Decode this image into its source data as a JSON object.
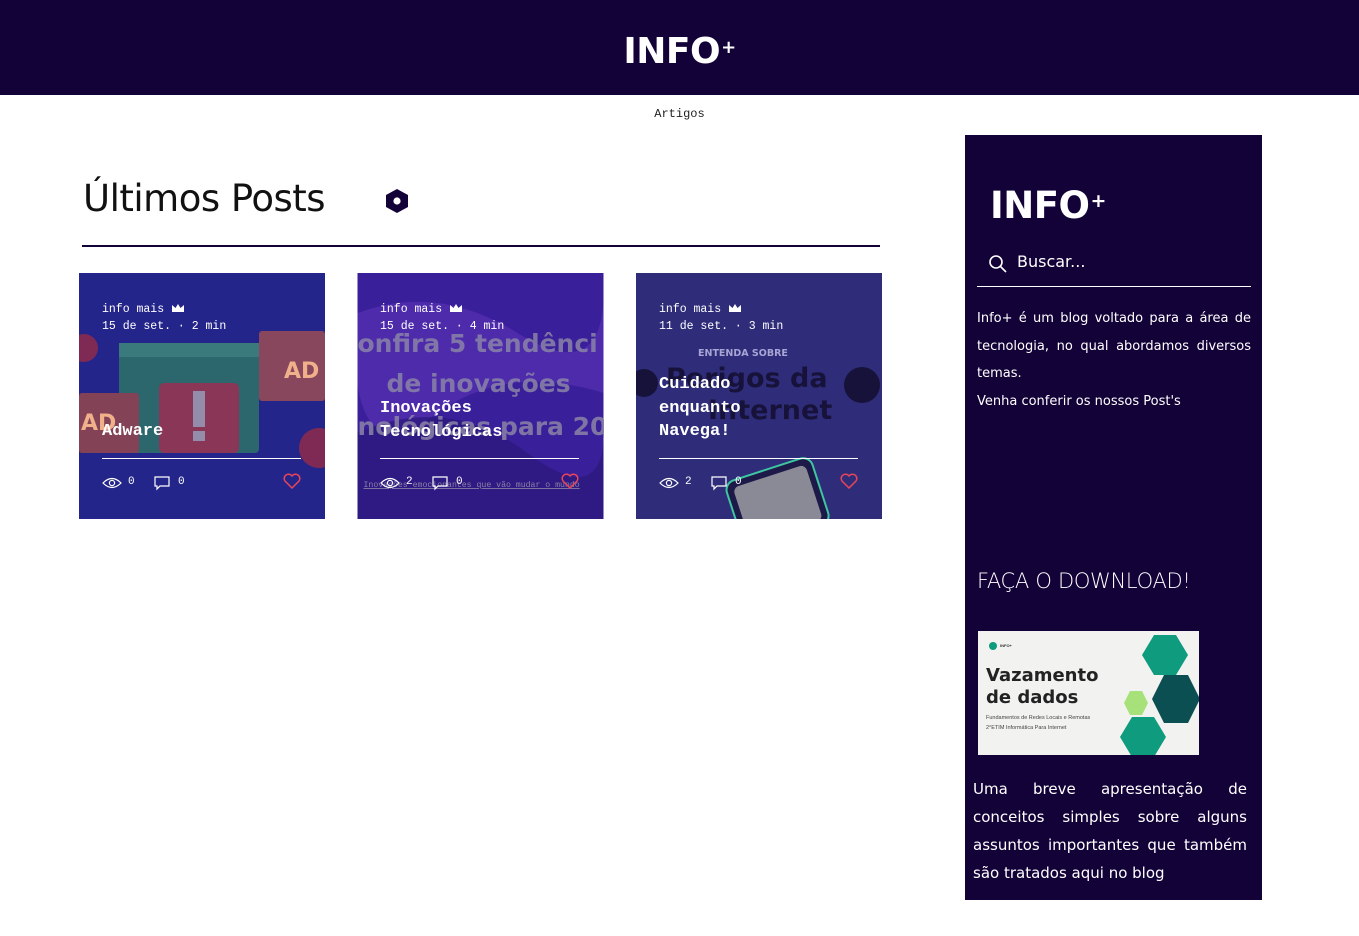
{
  "header": {
    "logo_text": "INFO",
    "logo_plus": "+"
  },
  "nav": {
    "item": "Artigos"
  },
  "main": {
    "title": "Últimos Posts"
  },
  "posts": [
    {
      "author": "info mais",
      "date_read": "15 de set. · 2 min",
      "title": "Adware",
      "views": "0",
      "comments": "0",
      "image_text": [
        "AD",
        "AD",
        "!"
      ]
    },
    {
      "author": "info mais",
      "date_read": "15 de set. · 4 min",
      "title": "Inovações Tecnológicas",
      "views": "2",
      "comments": "0",
      "image_text": [
        "onfira 5 tendênci",
        "de inovações",
        "nológicas para 20",
        "Inovações emocionantes que vão mudar o mundo"
      ]
    },
    {
      "author": "info mais",
      "date_read": "11 de set. · 3 min",
      "title": "Cuidado enquanto Navega!",
      "views": "2",
      "comments": "0",
      "image_text": [
        "ENTENDA SOBRE",
        "Perigos da",
        "Internet"
      ]
    }
  ],
  "sidebar": {
    "logo_text": "INFO",
    "logo_plus": "+",
    "search_placeholder": "Buscar...",
    "about_1": "Info+ é um blog voltado para a área de tecnologia, no qual abordamos diversos temas.",
    "about_2": "Venha conferir os nossos Post's",
    "download_title": "FAÇA O DOWNLOAD!",
    "thumb_title": "Vazamento de dados",
    "thumb_sub_1": "Fundamentos de Redes Locais e Remotas",
    "thumb_sub_2": "2°ETIM  Informática Para Internet",
    "thumb_mini": "INFO+",
    "download_desc": "Uma breve apresentação de conceitos simples sobre alguns assuntos importantes que também são tratados aqui no blog"
  },
  "colors": {
    "brand": "#130238",
    "heart": "#e8455a",
    "card1": "#2a2a8c",
    "card2": "#3a1f9a",
    "card3": "#2f2d7a"
  }
}
